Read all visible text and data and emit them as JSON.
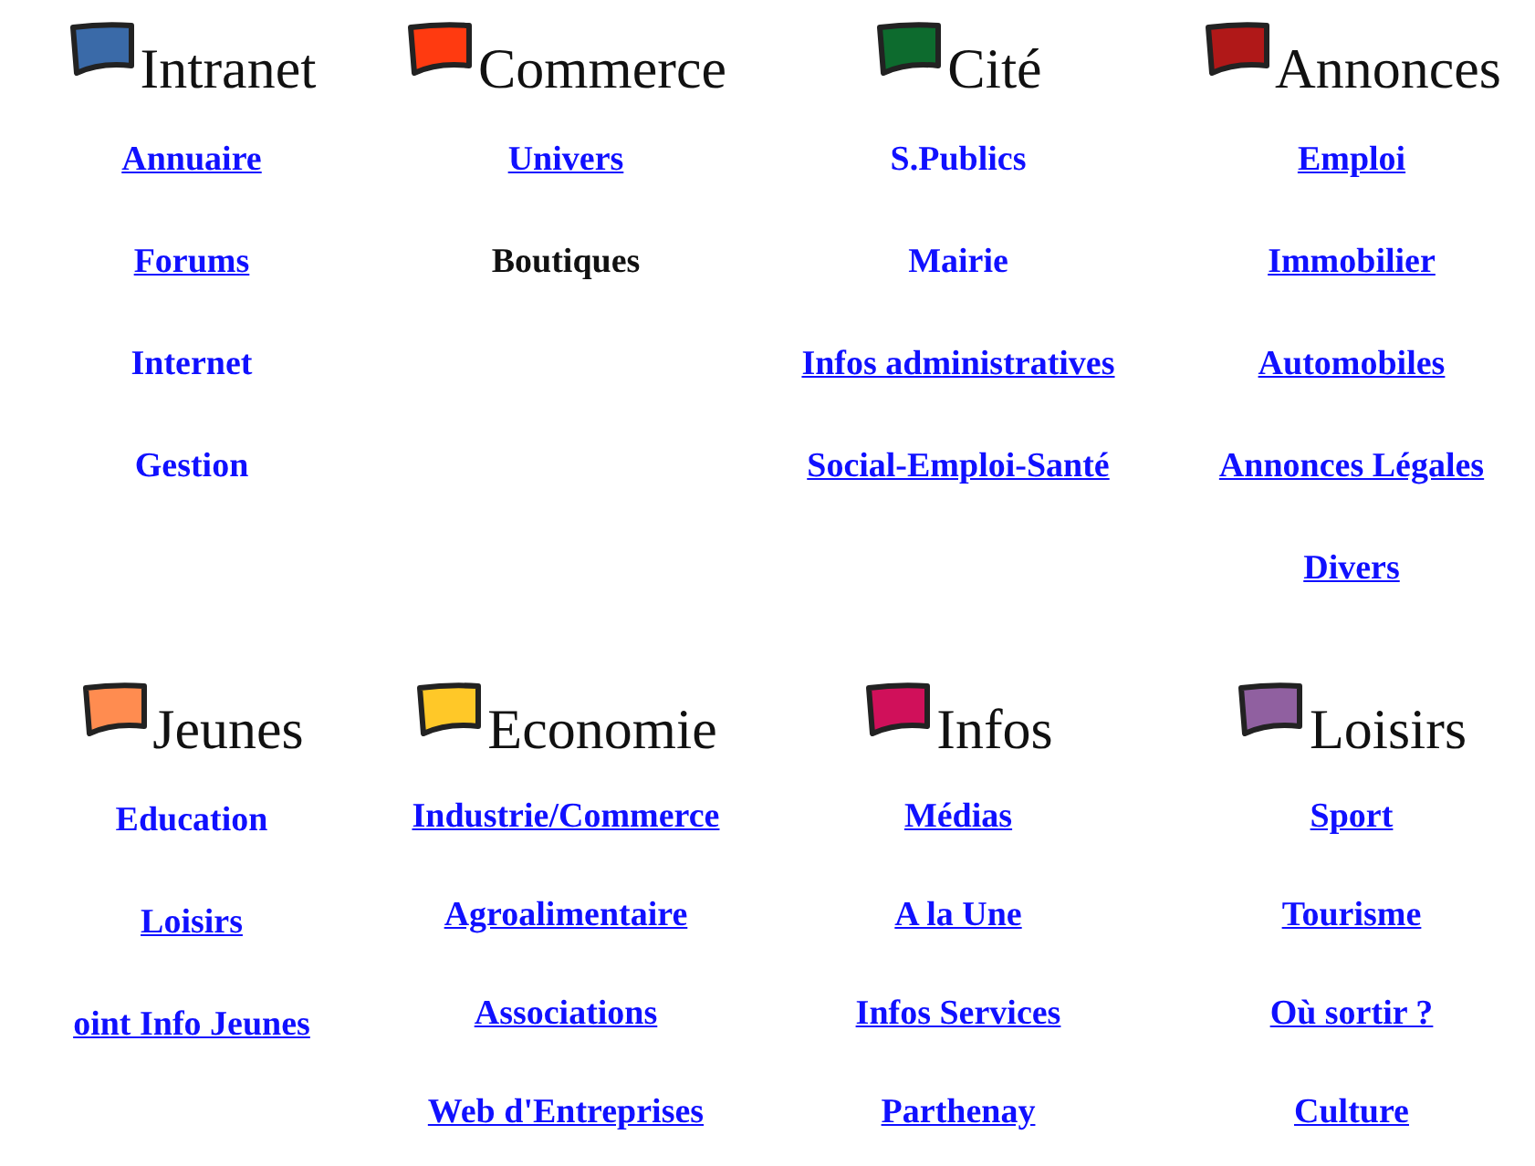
{
  "sections": [
    {
      "title": "Intranet",
      "color": "#3a6aa8",
      "items": [
        {
          "label": "Annuaire ",
          "kind": "link"
        },
        {
          "label": "Forums",
          "kind": "link"
        },
        {
          "label": "Internet",
          "kind": "label"
        },
        {
          "label": "Gestion",
          "kind": "label"
        }
      ]
    },
    {
      "title": "Commerce",
      "color": "#ff3a10",
      "items": [
        {
          "label": "Univers",
          "kind": "link"
        },
        {
          "label": "Boutiques",
          "kind": "text"
        }
      ]
    },
    {
      "title": "Cité",
      "color": "#0d6b2e",
      "items": [
        {
          "label": "S.Publics",
          "kind": "label"
        },
        {
          "label": "Mairie",
          "kind": "label"
        },
        {
          "label": "Infos administratives",
          "kind": "link"
        },
        {
          "label": "Social-Emploi-Santé",
          "kind": "link"
        }
      ]
    },
    {
      "title": "Annonces",
      "color": "#b01818",
      "items": [
        {
          "label": "Emploi",
          "kind": "link"
        },
        {
          "label": "Immobilier",
          "kind": "link"
        },
        {
          "label": "Automobiles",
          "kind": "link"
        },
        {
          "label": "Annonces Légales",
          "kind": "link"
        },
        {
          "label": "Divers",
          "kind": "link"
        }
      ]
    },
    {
      "title": "Jeunes",
      "color": "#ff8c50",
      "items": [
        {
          "label": "Education",
          "kind": "label"
        },
        {
          "label": "Loisirs",
          "kind": "link"
        },
        {
          "label": "oint Info Jeunes",
          "kind": "link"
        }
      ]
    },
    {
      "title": "Economie",
      "color": "#ffc828",
      "items": [
        {
          "label": "Industrie/Commerce",
          "kind": "link"
        },
        {
          "label": "Agroalimentaire",
          "kind": "link"
        },
        {
          "label": "Associations",
          "kind": "link"
        },
        {
          "label": "Web d'Entreprises",
          "kind": "link"
        }
      ]
    },
    {
      "title": "Infos",
      "color": "#d0105a",
      "items": [
        {
          "label": "Médias",
          "kind": "link"
        },
        {
          "label": "A la Une",
          "kind": "link"
        },
        {
          "label": "Infos Services",
          "kind": "link"
        },
        {
          "label": "Parthenay",
          "kind": "link"
        }
      ]
    },
    {
      "title": "Loisirs",
      "color": "#9060a0",
      "items": [
        {
          "label": "Sport",
          "kind": "link"
        },
        {
          "label": "Tourisme",
          "kind": "link"
        },
        {
          "label": "Où sortir ?",
          "kind": "link"
        },
        {
          "label": "Culture",
          "kind": "link"
        }
      ]
    }
  ]
}
